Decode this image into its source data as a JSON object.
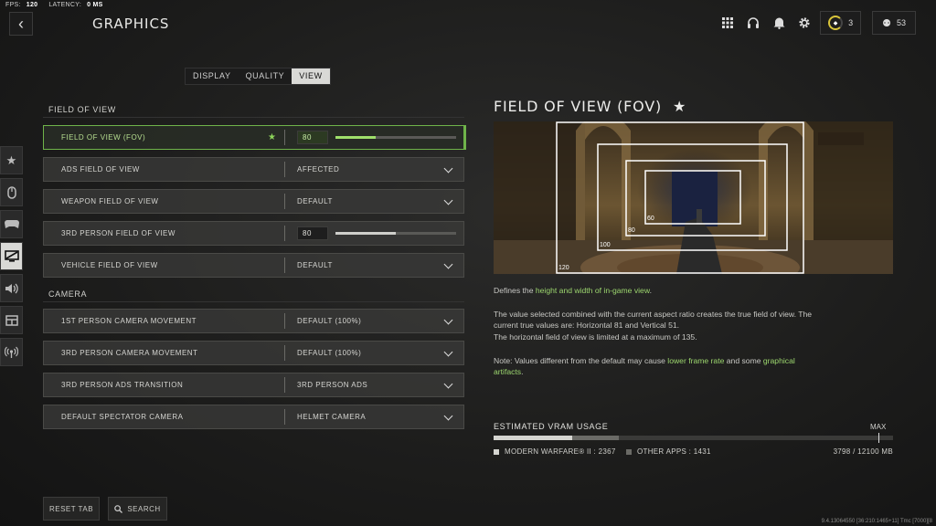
{
  "stats": {
    "fps_label": "FPS:",
    "fps": "120",
    "latency_label": "LATENCY:",
    "latency": "0 MS"
  },
  "header": {
    "title": "GRAPHICS",
    "rank_level": "3",
    "friends_count": "53"
  },
  "tabs": [
    {
      "label": "DISPLAY"
    },
    {
      "label": "QUALITY"
    },
    {
      "label": "VIEW"
    }
  ],
  "sections": {
    "fov": "FIELD OF VIEW",
    "camera": "CAMERA"
  },
  "rows": [
    {
      "label": "FIELD OF VIEW (FOV)",
      "value": "80",
      "slider_fraction": 0.33
    },
    {
      "label": "ADS FIELD OF VIEW",
      "value": "AFFECTED"
    },
    {
      "label": "WEAPON FIELD OF VIEW",
      "value": "DEFAULT"
    },
    {
      "label": "3RD PERSON FIELD OF VIEW",
      "value": "80",
      "slider_fraction": 0.5
    },
    {
      "label": "VEHICLE FIELD OF VIEW",
      "value": "DEFAULT"
    },
    {
      "label": "1ST PERSON CAMERA MOVEMENT",
      "value": "DEFAULT (100%)"
    },
    {
      "label": "3RD PERSON CAMERA MOVEMENT",
      "value": "DEFAULT (100%)"
    },
    {
      "label": "3RD PERSON ADS TRANSITION",
      "value": "3RD PERSON ADS"
    },
    {
      "label": "DEFAULT SPECTATOR CAMERA",
      "value": "HELMET CAMERA"
    }
  ],
  "buttons": {
    "reset": "RESET TAB",
    "search": "SEARCH"
  },
  "detail": {
    "title": "FIELD OF VIEW (FOV)",
    "star": "★",
    "fov_marks": [
      "120",
      "100",
      "80",
      "60"
    ],
    "p1_pre": "Defines the ",
    "p1_hl": "height and width of in-game view",
    "p1_post": ".",
    "p2_l1": "The value selected combined with the current aspect ratio creates the true field of view. The",
    "p2_l2": "current true values are: Horizontal 81 and Vertical 51.",
    "p2_l3": "The horizontal field of view is limited at a maximum of 135.",
    "p3_pre": "Note: Values different from the default may cause ",
    "p3_hl1": "lower frame rate",
    "p3_mid": " and some ",
    "p3_hl2": "graphical",
    "p3_hl3": "artifacts",
    "p3_post": "."
  },
  "vram": {
    "title": "ESTIMATED VRAM USAGE",
    "max_label": "MAX",
    "mw_label": "MODERN WARFARE® II : 2367",
    "other_label": "OTHER APPS : 1431",
    "total": "3798 / 12100 MB",
    "mw_fraction": 0.196,
    "other_fraction": 0.118
  },
  "footer": {
    "version": "9.4.13064550 [36:210:1465+11] Tmc [7000][8"
  },
  "colors": {
    "accent": "#6fb44a",
    "highlight_text": "#9cd66e"
  }
}
